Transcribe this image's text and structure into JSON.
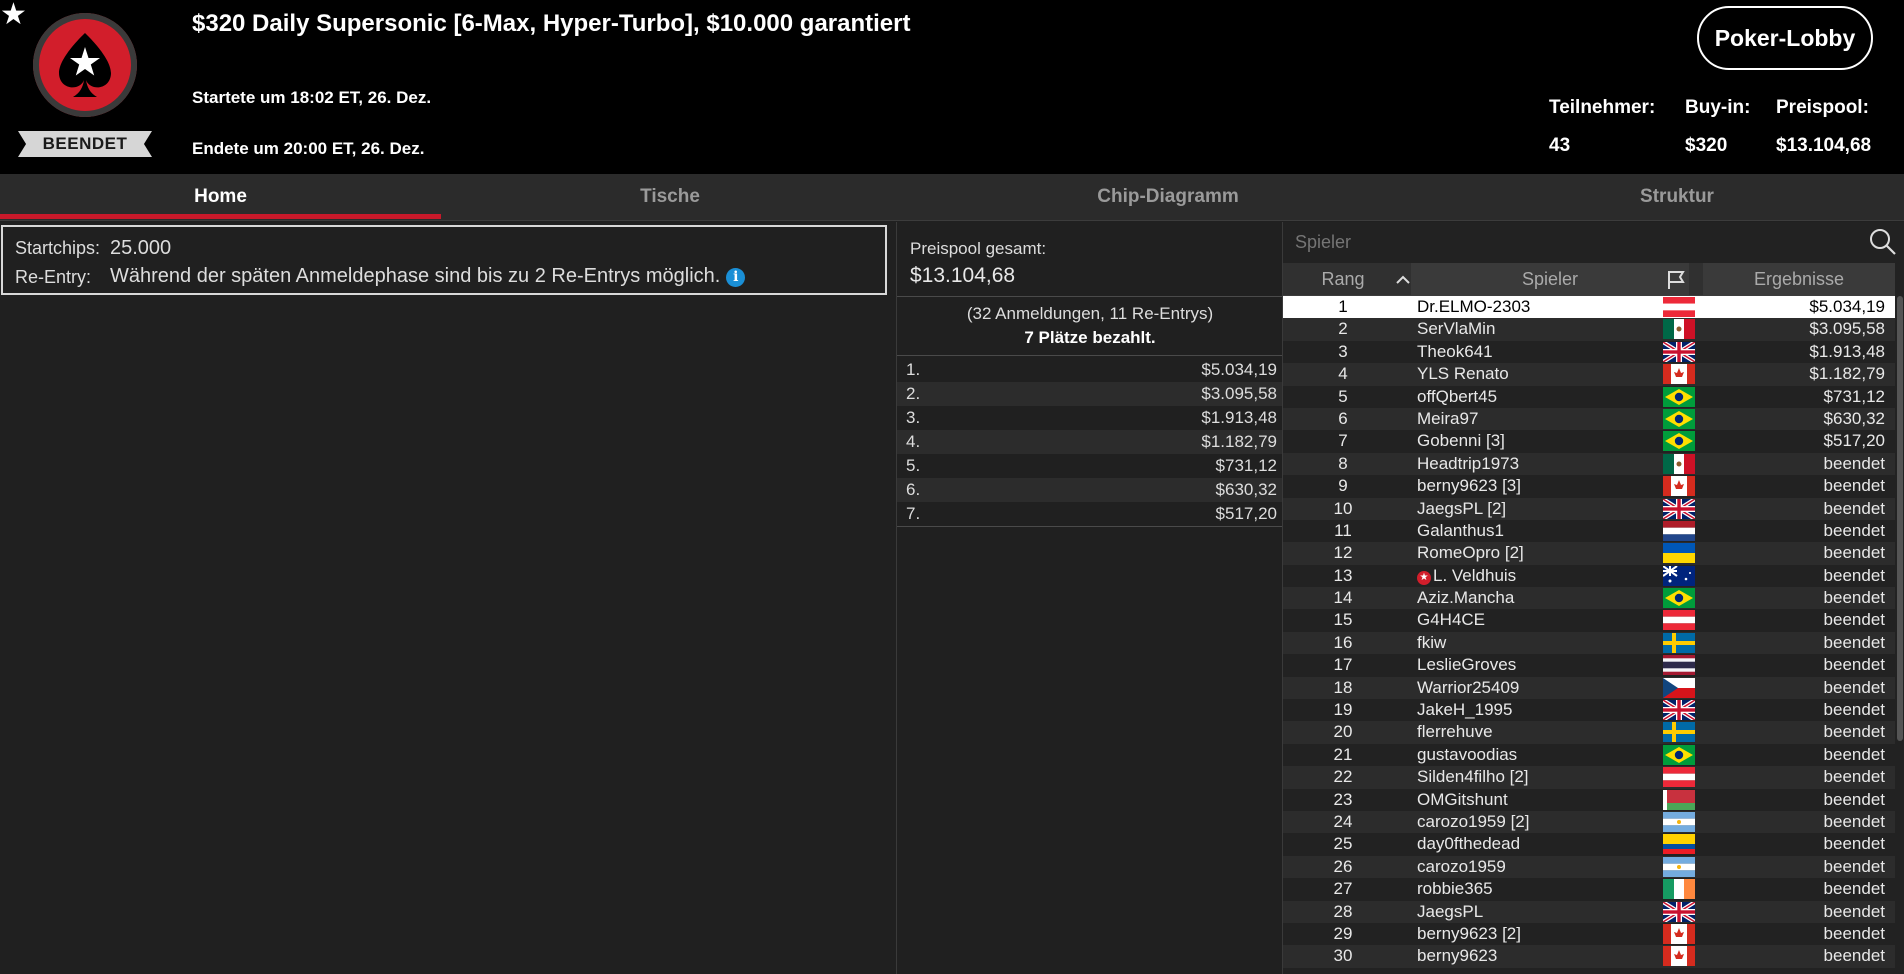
{
  "header": {
    "favorite_icon": "star-icon",
    "status": "BEENDET",
    "title": "$320 Daily Supersonic [6-Max, Hyper-Turbo], $10.000 garantiert",
    "started": "Startete um 18:02 ET, 26. Dez.",
    "ended": "Endete um 20:00 ET, 26. Dez.",
    "lobby_button": "Poker-Lobby",
    "stats": [
      {
        "label": "Teilnehmer:",
        "value": "43"
      },
      {
        "label": "Buy-in:",
        "value": "$320"
      },
      {
        "label": "Preispool:",
        "value": "$13.104,68"
      }
    ]
  },
  "tabs": [
    "Home",
    "Tische",
    "Chip-Diagramm",
    "Struktur"
  ],
  "active_tab": "Home",
  "info": {
    "startchips_label": "Startchips:",
    "startchips_value": "25.000",
    "reentry_label": "Re-Entry:",
    "reentry_value": "Während der späten Anmeldephase sind bis zu 2 Re-Entrys möglich."
  },
  "prize_pool": {
    "label": "Preispool gesamt:",
    "amount": "$13.104,68",
    "entries": "(32 Anmeldungen, 11 Re-Entrys)",
    "paid": "7 Plätze bezahlt.",
    "payouts": [
      {
        "pos": "1.",
        "amount": "$5.034,19"
      },
      {
        "pos": "2.",
        "amount": "$3.095,58"
      },
      {
        "pos": "3.",
        "amount": "$1.913,48"
      },
      {
        "pos": "4.",
        "amount": "$1.182,79"
      },
      {
        "pos": "5.",
        "amount": "$731,12"
      },
      {
        "pos": "6.",
        "amount": "$630,32"
      },
      {
        "pos": "7.",
        "amount": "$517,20"
      }
    ]
  },
  "players": {
    "search_placeholder": "Spieler",
    "columns": {
      "rank": "Rang",
      "player": "Spieler",
      "flag_icon": "flag-icon",
      "results": "Ergebnisse"
    },
    "rows": [
      {
        "rank": "1",
        "name": "Dr.ELMO-2303",
        "flag": "austria",
        "result": "$5.034,19"
      },
      {
        "rank": "2",
        "name": "SerVlaMin",
        "flag": "mexico",
        "result": "$3.095,58"
      },
      {
        "rank": "3",
        "name": "Theok641",
        "flag": "uk",
        "result": "$1.913,48"
      },
      {
        "rank": "4",
        "name": "YLS Renato",
        "flag": "canada",
        "result": "$1.182,79"
      },
      {
        "rank": "5",
        "name": "offQbert45",
        "flag": "brazil",
        "result": "$731,12"
      },
      {
        "rank": "6",
        "name": "Meira97",
        "flag": "brazil",
        "result": "$630,32"
      },
      {
        "rank": "7",
        "name": "Gobenni [3]",
        "flag": "brazil",
        "result": "$517,20"
      },
      {
        "rank": "8",
        "name": "Headtrip1973",
        "flag": "mexico",
        "result": "beendet"
      },
      {
        "rank": "9",
        "name": "berny9623 [3]",
        "flag": "canada",
        "result": "beendet"
      },
      {
        "rank": "10",
        "name": "JaegsPL [2]",
        "flag": "uk",
        "result": "beendet"
      },
      {
        "rank": "11",
        "name": "Galanthus1",
        "flag": "netherlands",
        "result": "beendet"
      },
      {
        "rank": "12",
        "name": "RomeOpro [2]",
        "flag": "ukraine",
        "result": "beendet"
      },
      {
        "rank": "13",
        "name": "L. Veldhuis",
        "flag": "australia",
        "result": "beendet",
        "pro": true
      },
      {
        "rank": "14",
        "name": "Aziz.Mancha",
        "flag": "brazil",
        "result": "beendet"
      },
      {
        "rank": "15",
        "name": "G4H4CE",
        "flag": "austria",
        "result": "beendet"
      },
      {
        "rank": "16",
        "name": "fkiw",
        "flag": "sweden",
        "result": "beendet"
      },
      {
        "rank": "17",
        "name": "LeslieGroves",
        "flag": "thailand",
        "result": "beendet"
      },
      {
        "rank": "18",
        "name": "Warrior25409",
        "flag": "czech",
        "result": "beendet"
      },
      {
        "rank": "19",
        "name": "JakeH_1995",
        "flag": "uk",
        "result": "beendet"
      },
      {
        "rank": "20",
        "name": "flerrehuve",
        "flag": "sweden",
        "result": "beendet"
      },
      {
        "rank": "21",
        "name": "gustavoodias",
        "flag": "brazil",
        "result": "beendet"
      },
      {
        "rank": "22",
        "name": "Silden4filho [2]",
        "flag": "austria",
        "result": "beendet"
      },
      {
        "rank": "23",
        "name": "OMGitshunt",
        "flag": "belarus",
        "result": "beendet"
      },
      {
        "rank": "24",
        "name": "carozo1959 [2]",
        "flag": "argentina",
        "result": "beendet"
      },
      {
        "rank": "25",
        "name": "day0fthedead",
        "flag": "ecuador",
        "result": "beendet"
      },
      {
        "rank": "26",
        "name": "carozo1959",
        "flag": "argentina",
        "result": "beendet"
      },
      {
        "rank": "27",
        "name": "robbie365",
        "flag": "ireland",
        "result": "beendet"
      },
      {
        "rank": "28",
        "name": "JaegsPL",
        "flag": "uk",
        "result": "beendet"
      },
      {
        "rank": "29",
        "name": "berny9623 [2]",
        "flag": "canada",
        "result": "beendet"
      },
      {
        "rank": "30",
        "name": "berny9623",
        "flag": "canada",
        "result": "beendet"
      }
    ]
  },
  "colors": {
    "accent": "#c8192a",
    "brand_red": "#d21e2b",
    "info_blue": "#1a8fd6"
  }
}
